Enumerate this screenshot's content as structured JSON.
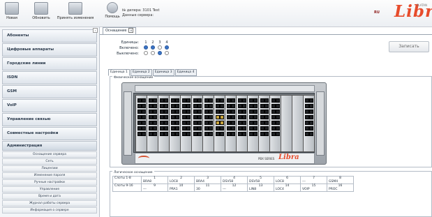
{
  "toolbar": {
    "buttons": [
      {
        "label": "Новая",
        "icon": "new-icon"
      },
      {
        "label": "Обновить",
        "icon": "refresh-icon"
      },
      {
        "label": "Принять изменения",
        "icon": "apply-icon"
      },
      {
        "label": "Помощь",
        "icon": "help-icon"
      }
    ],
    "dealer_line1": "№ дилера: 3101 Test",
    "dealer_line2": "Данные сервера:",
    "lang": "RU",
    "logo_text": "Libra",
    "logo_sub": "PLATAN"
  },
  "sidebar": {
    "items": [
      "Абоненты",
      "Цифровые аппараты",
      "Городские линии",
      "ISDN",
      "GSM",
      "VoIP",
      "Управление связью",
      "Совместные настройки"
    ],
    "admin_label": "Администрация",
    "admin_subitems": [
      "Оснащение сервера",
      "Сеть",
      "Лицензии",
      "Изменение пароля",
      "Ручные настройки",
      "Управление",
      "Время и дата",
      "Журнал работы сервера",
      "Информация о сервере"
    ]
  },
  "main": {
    "tab_label": "Оснащение",
    "units": {
      "label_units": "Единицы:",
      "label_on": "Включено:",
      "label_off": "Выключено:",
      "numbers": [
        "1",
        "2",
        "3",
        "4"
      ],
      "on_states": [
        true,
        true,
        false,
        true
      ],
      "off_states": [
        false,
        false,
        true,
        false
      ]
    },
    "save_label": "Записать",
    "sub_tabs": [
      "Единица 1",
      "Единица 2",
      "Единица 3",
      "Единица 4"
    ],
    "physical_legend": "Физическое оснащение",
    "chassis_label": "PBX SERIES",
    "chassis_logo": "Libra",
    "logical_legend": "Логическое оснащение",
    "logic_rows": [
      {
        "header": "Слоты 1-8",
        "slots": [
          {
            "num": "1",
            "val": "BRA8"
          },
          {
            "num": "2",
            "val": "LOC8"
          },
          {
            "num": "3",
            "val": "BRA4"
          },
          {
            "num": "4",
            "val": "DSV58"
          },
          {
            "num": "5",
            "val": "DSV58"
          },
          {
            "num": "6",
            "val": "LOC8"
          },
          {
            "num": "7",
            "val": "---"
          },
          {
            "num": "8",
            "val": "GSM4"
          }
        ]
      },
      {
        "header": "Слоты 9-16",
        "slots": [
          {
            "num": "9",
            "val": "---"
          },
          {
            "num": "10",
            "val": "PRA1"
          },
          {
            "num": "11",
            "val": "30"
          },
          {
            "num": "12",
            "val": "---"
          },
          {
            "num": "13",
            "val": "LIN8"
          },
          {
            "num": "14",
            "val": "LOC4"
          },
          {
            "num": "15",
            "val": "VOIP"
          },
          {
            "num": "16",
            "val": "PROC"
          }
        ]
      }
    ]
  },
  "colors": {
    "brand": "#e74c2c",
    "radio_on": "#3a73c6"
  }
}
